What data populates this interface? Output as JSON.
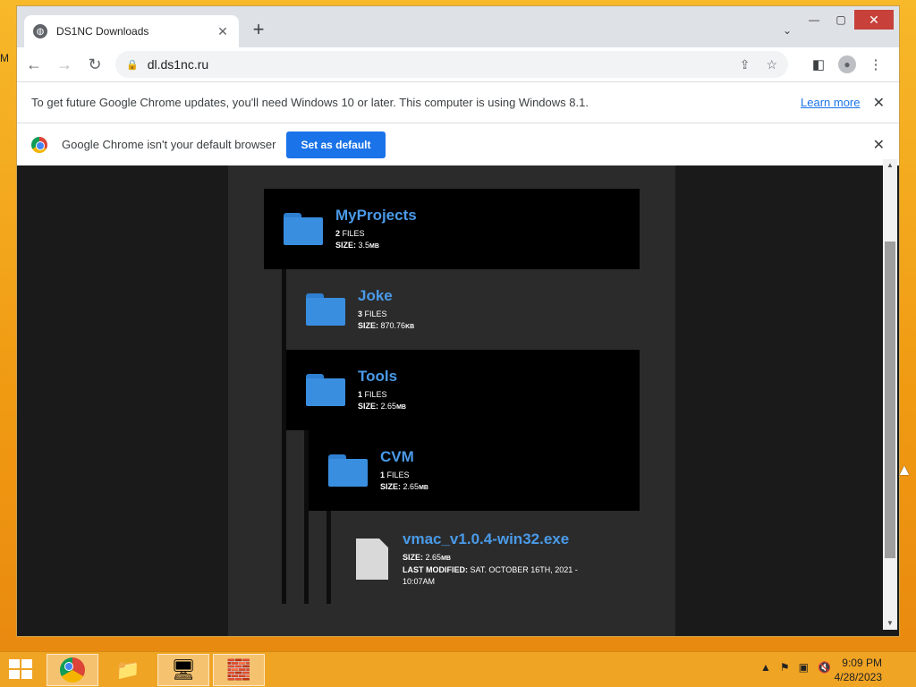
{
  "browser": {
    "tab_title": "DS1NC Downloads",
    "tab_close": "✕",
    "new_tab": "+",
    "url": "dl.ds1nc.ru"
  },
  "infobars": {
    "update_message": "To get future Google Chrome updates, you'll need Windows 10 or later. This computer is using Windows 8.1.",
    "learn_more": "Learn more",
    "default_message": "Google Chrome isn't your default browser",
    "set_default": "Set as default"
  },
  "tree": [
    {
      "name": "MyProjects",
      "files_count": "2",
      "files_label": "FILES",
      "size_label": "SIZE:",
      "size": "3.5",
      "size_unit": "MB"
    },
    {
      "name": "Joke",
      "files_count": "3",
      "files_label": "FILES",
      "size_label": "SIZE:",
      "size": "870.76",
      "size_unit": "KB"
    },
    {
      "name": "Tools",
      "files_count": "1",
      "files_label": "FILES",
      "size_label": "SIZE:",
      "size": "2.65",
      "size_unit": "MB"
    },
    {
      "name": "CVM",
      "files_count": "1",
      "files_label": "FILES",
      "size_label": "SIZE:",
      "size": "2.65",
      "size_unit": "MB"
    },
    {
      "name": "vmac_v1.0.4-win32.exe",
      "size_label": "SIZE:",
      "size": "2.65",
      "size_unit": "MB",
      "modified_label": "LAST MODIFIED:",
      "modified": "SAT. OCTOBER 16TH, 2021 - 10:07AM"
    }
  ],
  "taskbar": {
    "time": "9:09 PM",
    "date": "4/28/2023"
  },
  "colors": {
    "link_blue": "#4a9ae8",
    "chrome_blue": "#1a73e8",
    "desktop_orange": "#f3a417"
  }
}
